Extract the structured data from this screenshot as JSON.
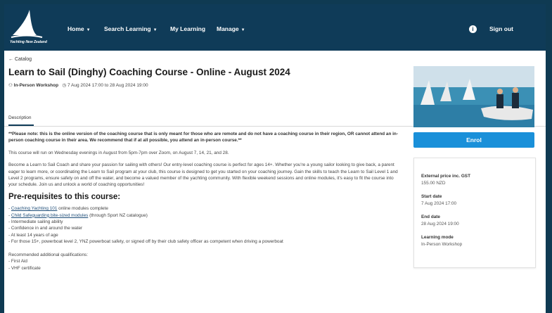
{
  "header": {
    "logo_text": "Yachting New Zealand",
    "nav": [
      {
        "label": "Home",
        "caret": true
      },
      {
        "label": "Search Learning",
        "caret": true
      },
      {
        "label": "My Learning",
        "caret": false
      },
      {
        "label": "Manage",
        "caret": true
      }
    ],
    "avatar_glyph": "i",
    "signout": "Sign out"
  },
  "breadcrumb": "← Catalog",
  "course": {
    "title": "Learn to Sail (Dinghy) Coaching Course - Online - August 2024",
    "type": "In-Person Workshop",
    "dates": "7 Aug 2024 17:00 to 28 Aug 2024 19:00"
  },
  "tabs": [
    "Description"
  ],
  "description": {
    "note": "**Please note: this is the online version of the coaching course that is only meant for those who are remote and do not have a coaching course in their region, OR cannot attend an in-person coaching course in their area. We recommend that if at all possible, you attend an in-person course.**",
    "para1": "This course will run on Wednesday evenings in August from 5pm-7pm over Zoom, on August 7, 14, 21, and 28.",
    "para2": "Become a Learn to Sail Coach and share your passion for sailing with others! Our entry-level coaching course is perfect for ages 14+. Whether you're a young sailor looking to give back, a parent eager to learn more, or coordinating the Learn to Sail program at your club, this course is designed to get you started on your coaching journey. Gain the skills to teach the Learn to Sail Level 1 and Level 2 programs, ensure safety on and off the water, and become a valued member of the yachting community. With flexible weekend sessions and online modules, it's easy to fit the course into your schedule. Join us and unlock a world of coaching opportunities!",
    "prereq_heading": "Pre-requisites to this course:",
    "prereq1_link": "Coaching Yachting 101",
    "prereq1_rest": " online modules complete",
    "prereq2_link": "Child Safeguarding bite-sized modules",
    "prereq2_rest": " (through Sport NZ catalogue)",
    "prereq3": "- Intermediate sailing ability",
    "prereq4": "- Confidence in and around the water",
    "prereq5": "- At least 14 years of age",
    "prereq6": "- For those 15+, powerboat level 2, YNZ powerboat safety, or signed off by their club safety officer as competent when driving a powerboat",
    "recommended_heading": "Recommended additional qualifications:",
    "rec1": "- First Aid",
    "rec2": "- VHF certificate"
  },
  "sidebar": {
    "enrol_label": "Enrol",
    "price_label": "External price inc. GST",
    "price_value": "155.00 NZD",
    "start_label": "Start date",
    "start_value": "7 Aug 2024 17:00",
    "end_label": "End date",
    "end_value": "28 Aug 2024 19:00",
    "mode_label": "Learning mode",
    "mode_value": "In-Person Workshop"
  },
  "colors": {
    "header": "#0f3b58",
    "accent": "#1a90d9"
  }
}
